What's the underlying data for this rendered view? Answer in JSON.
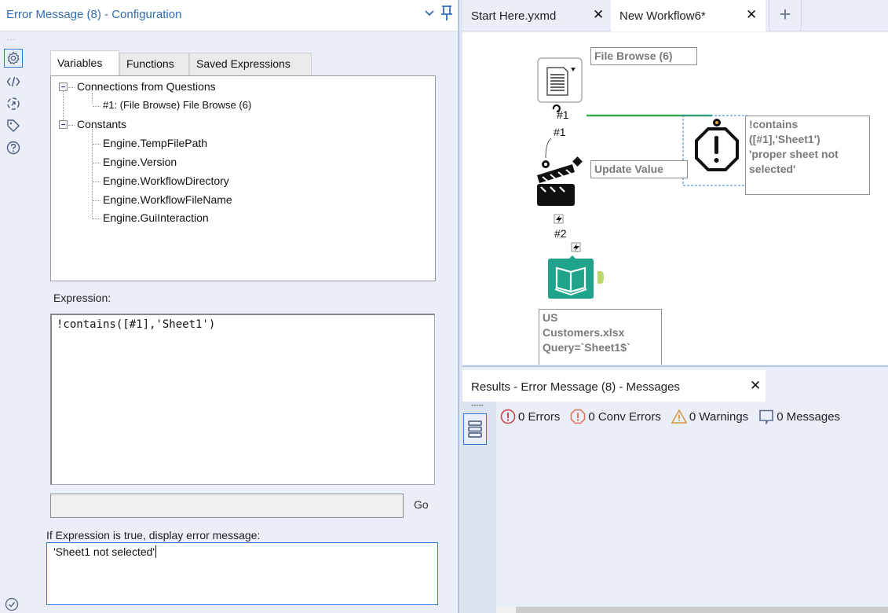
{
  "config_panel": {
    "title": "Error Message (8) - Configuration",
    "grip": "...",
    "side_icons": [
      "gear-icon",
      "code-icon",
      "annotation-icon",
      "tag-icon",
      "help-icon"
    ],
    "tabs": [
      {
        "label": "Variables",
        "active": true
      },
      {
        "label": "Functions",
        "active": false
      },
      {
        "label": "Saved Expressions",
        "active": false
      }
    ],
    "tree": {
      "groups": [
        {
          "label": "Connections from Questions",
          "expanded": true,
          "items": [
            "#1: (File Browse) File Browse (6)"
          ]
        },
        {
          "label": "Constants",
          "expanded": true,
          "items": [
            "Engine.TempFilePath",
            "Engine.Version",
            "Engine.WorkflowDirectory",
            "Engine.WorkflowFileName",
            "Engine.GuiInteraction"
          ]
        }
      ]
    },
    "expression_label": "Expression:",
    "expression_value": "!contains([#1],'Sheet1')",
    "go_field_value": "",
    "go_label": "Go",
    "message_label": "If Expression is true, display error message:",
    "message_value": "'Sheet1 not selected'"
  },
  "workflow_tabs": [
    {
      "label": "Start Here.yxmd",
      "active": false
    },
    {
      "label": "New Workflow6*",
      "active": true
    }
  ],
  "new_tab_label": "+",
  "close_glyph": "✕",
  "canvas": {
    "tools": [
      {
        "name": "File Browse",
        "annotation": "File Browse (6)"
      },
      {
        "name": "Action",
        "annotation": "Update Value"
      },
      {
        "name": "Error Message",
        "annotation": "!contains ([#1],'Sheet1') 'proper sheet not selected'"
      },
      {
        "name": "Input Data",
        "annotation": "US Customers.xlsx Query=`Sheet1$`"
      }
    ],
    "annotation_lines": {
      "error": [
        "!contains",
        "([#1],'Sheet1')",
        "'proper sheet not",
        "selected'"
      ],
      "input": [
        "US",
        "Customers.xlsx",
        "Query=`Sheet1$`"
      ]
    },
    "connection_labels": [
      "#1",
      "#1",
      "#2"
    ],
    "colors": {
      "connection_green": "#3aa757",
      "input_teal": "#1fa38a",
      "output_anchor": "#b7d96b",
      "selection_blue": "#2f7ad8"
    }
  },
  "results": {
    "tab_label": "Results - Error Message (8) - Messages",
    "filters": [
      {
        "icon": "error-icon",
        "count": "0",
        "label": "Errors",
        "color": "#d04545"
      },
      {
        "icon": "conv-error-icon",
        "count": "0",
        "label": "Conv Errors",
        "color": "#e07a5a"
      },
      {
        "icon": "warning-icon",
        "count": "0",
        "label": "Warnings",
        "color": "#d49a4a"
      },
      {
        "icon": "message-icon",
        "count": "0",
        "label": "Messages",
        "color": "#5a6d8a"
      }
    ],
    "filter_texts": [
      "0 Errors",
      "0 Conv Errors",
      "0 Warnings",
      "0 Messages"
    ]
  }
}
